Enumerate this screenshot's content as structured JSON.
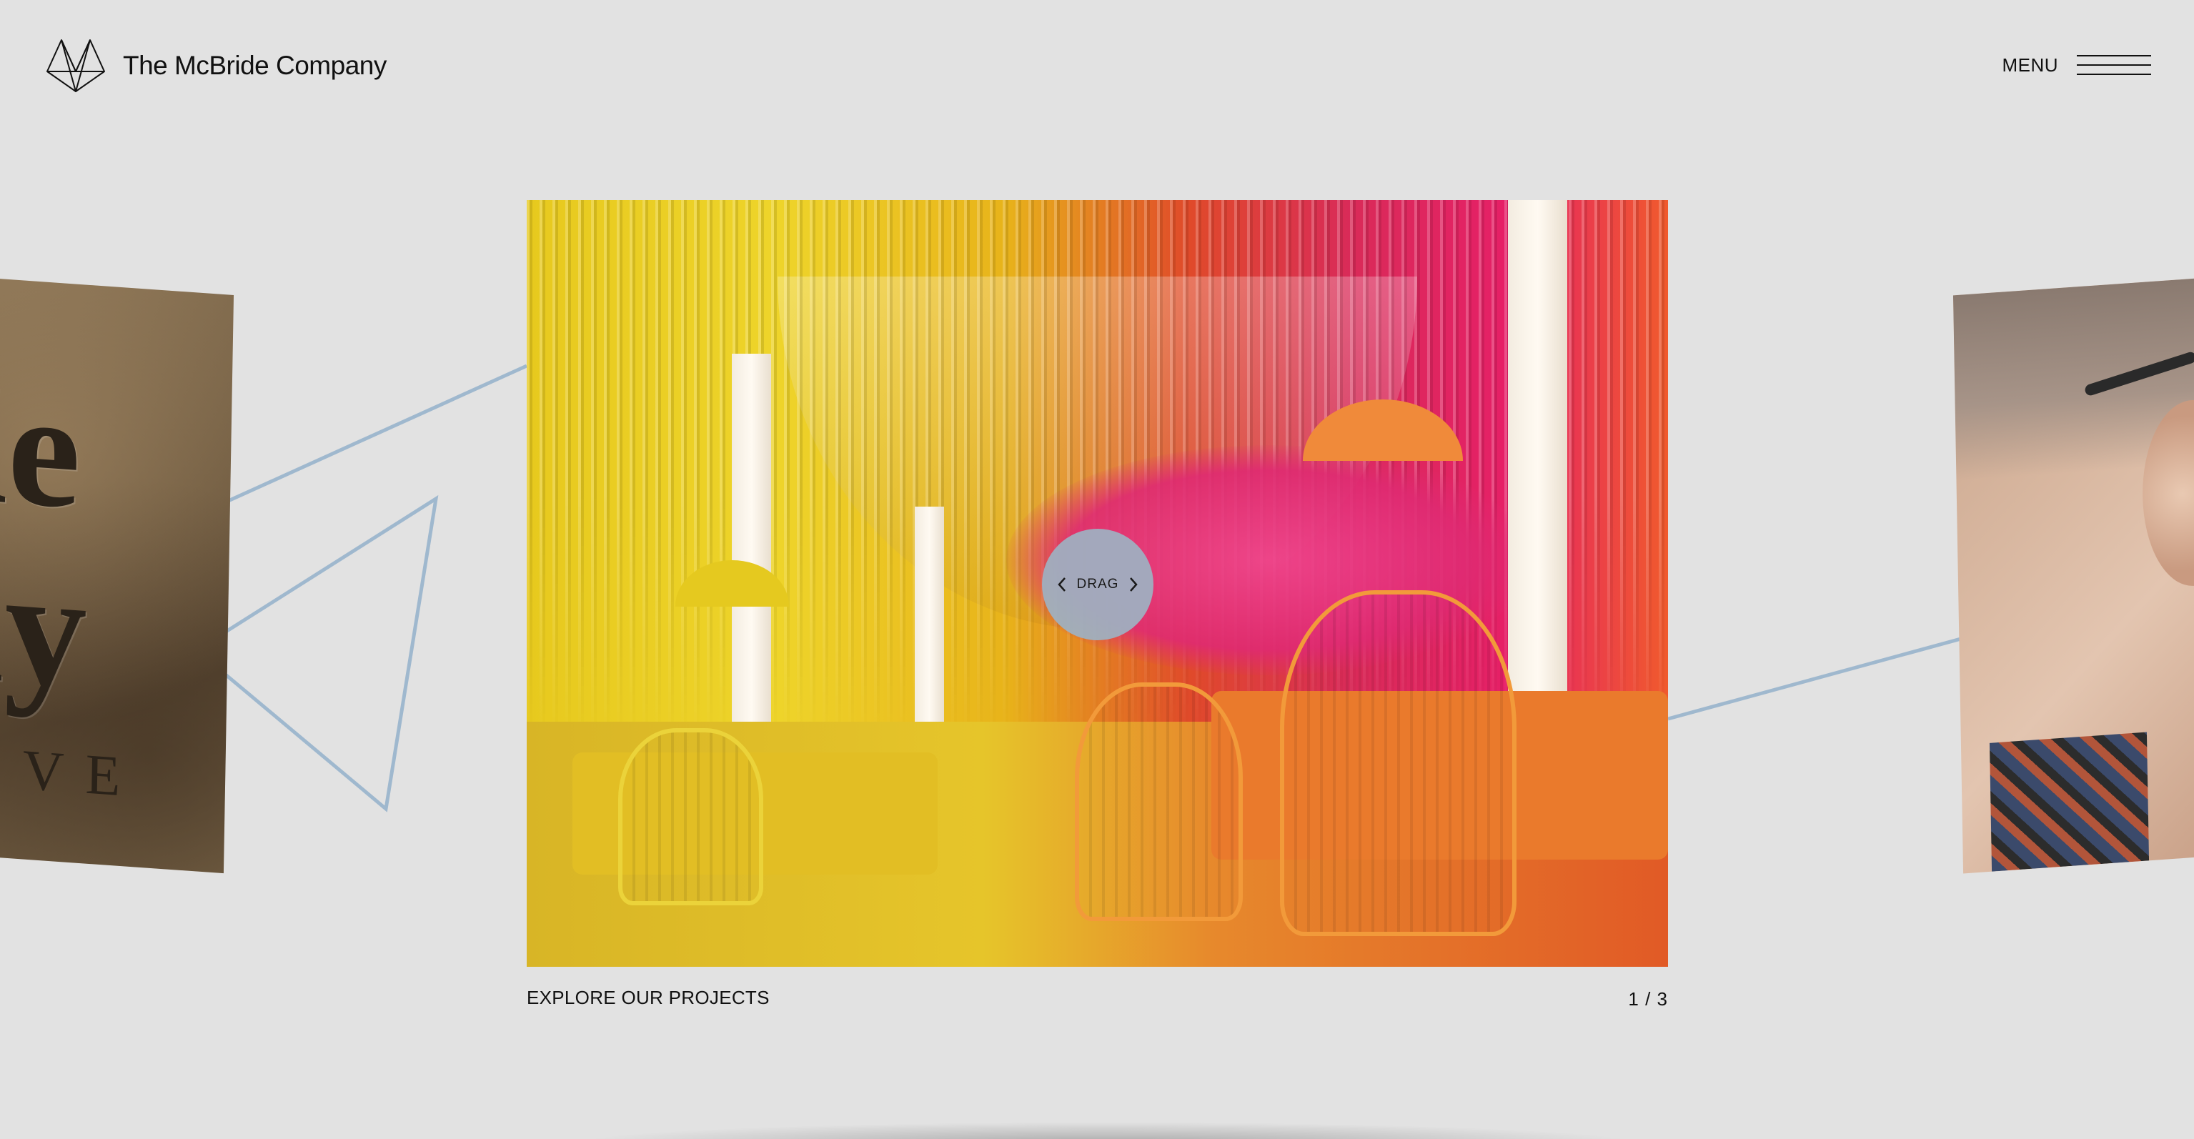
{
  "header": {
    "brand_name": "The McBride Company",
    "menu_label": "MENU"
  },
  "carousel": {
    "drag_label": "DRAG",
    "caption": "EXPLORE OUR PROJECTS",
    "counter": "1 / 3",
    "current_index": 1,
    "total": 3,
    "left_card_text_line1": "de",
    "left_card_text_line2": "ny",
    "left_card_text_line3": "IVE"
  },
  "colors": {
    "background": "#e2e2e2",
    "accent_line": "#9fb8ce",
    "drag_circle": "#9db2c2",
    "text": "#111111"
  },
  "icons": {
    "logo": "geometric-wing-logo-icon",
    "menu": "hamburger-menu-icon",
    "drag_prev": "chevron-left-icon",
    "drag_next": "chevron-right-icon"
  }
}
